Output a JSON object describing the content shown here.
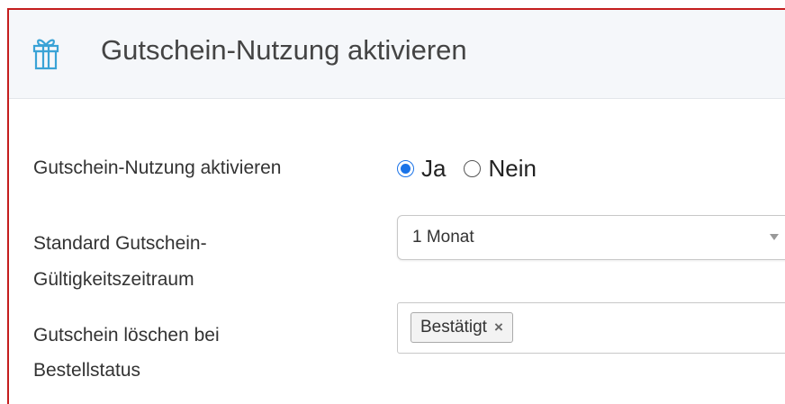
{
  "header": {
    "icon": "gift-icon",
    "title": "Gutschein-Nutzung aktivieren"
  },
  "form": {
    "enable_voucher": {
      "label": "Gutschein-Nutzung aktivieren",
      "options": [
        {
          "label": "Ja",
          "checked": true
        },
        {
          "label": "Nein",
          "checked": false
        }
      ]
    },
    "validity_period": {
      "label_line1": "Standard Gutschein-",
      "label_line2": "Gültigkeitszeitraum",
      "selected": "1 Monat"
    },
    "delete_on_status": {
      "label_line1": "Gutschein löschen bei",
      "label_line2": "Bestellstatus",
      "tags": [
        {
          "label": "Bestätigt",
          "remove": "×"
        }
      ]
    }
  },
  "colors": {
    "accent": "#1a73e8",
    "panel_border": "#c41e1e",
    "header_bg": "#f5f7fa",
    "icon": "#3aa3d6"
  }
}
